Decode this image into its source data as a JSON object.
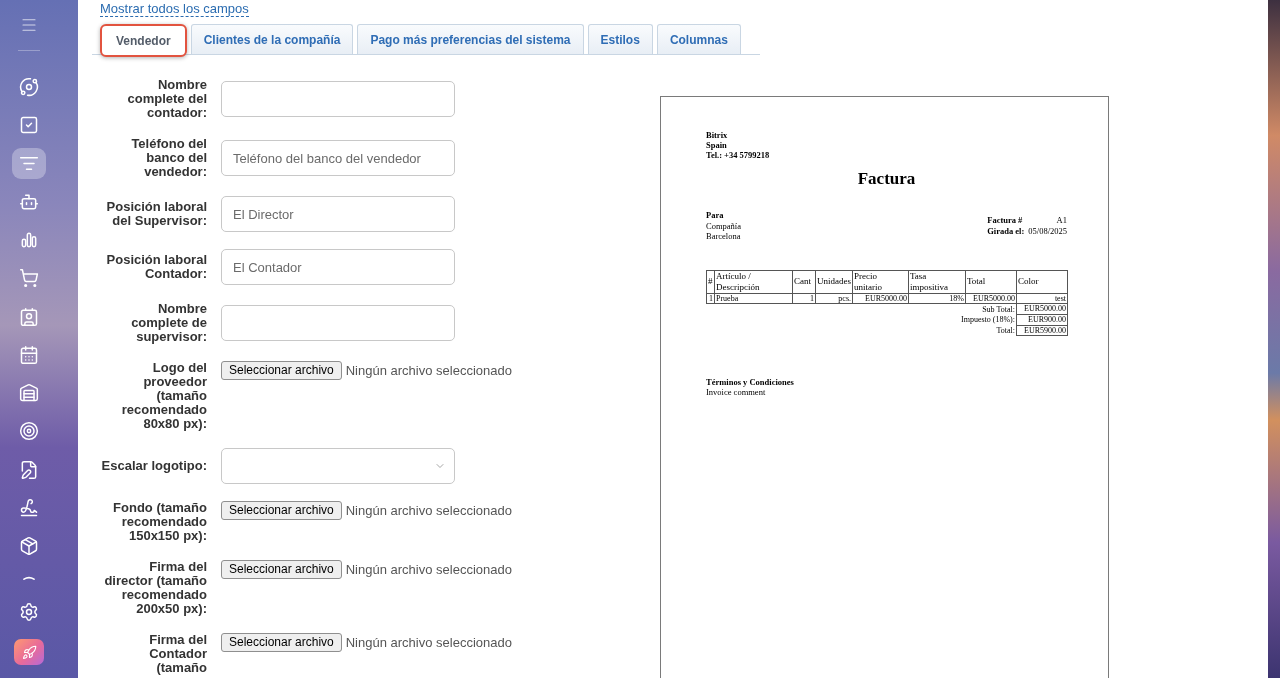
{
  "sidebar": {
    "nav_items": [
      {
        "selected": false
      },
      {
        "selected": false
      },
      {
        "selected": true
      },
      {
        "selected": false
      },
      {
        "selected": false
      },
      {
        "selected": false
      },
      {
        "selected": false
      },
      {
        "selected": false
      },
      {
        "selected": false
      },
      {
        "selected": false
      },
      {
        "selected": false
      },
      {
        "selected": false
      },
      {
        "selected": false
      }
    ]
  },
  "link": "Mostrar todos los campos",
  "tabs": [
    {
      "label": "Vendedor",
      "selected": true,
      "highlighted": true
    },
    {
      "label": "Clientes de la compañía",
      "selected": false,
      "highlighted": false
    },
    {
      "label": "Pago más preferencias del sistema",
      "selected": false,
      "highlighted": false
    },
    {
      "label": "Estilos",
      "selected": false,
      "highlighted": false
    },
    {
      "label": "Columnas",
      "selected": false,
      "highlighted": false
    }
  ],
  "form": {
    "fields": [
      {
        "kind": "text",
        "label": "Nombre complete del contador:"
      },
      {
        "kind": "text",
        "label": "Teléfono del banco del vendedor:",
        "placeholder": "Teléfono del banco del vendedor"
      },
      {
        "kind": "text",
        "label": "Posición laboral del Supervisor:",
        "placeholder": "El Director"
      },
      {
        "kind": "text",
        "label": "Posición laboral Contador:",
        "placeholder": "El Contador"
      },
      {
        "kind": "text",
        "label": "Nombre complete de supervisor:"
      },
      {
        "kind": "file",
        "label": "Logo del proveedor (tamaño recomendado 80x80 px):",
        "button": "Seleccionar archivo",
        "status": "Ningún archivo seleccionado"
      },
      {
        "kind": "select",
        "label": "Escalar logotipo:"
      },
      {
        "kind": "file",
        "label": "Fondo (tamaño recomendado 150x150 px):",
        "button": "Seleccionar archivo",
        "status": "Ningún archivo seleccionado"
      },
      {
        "kind": "file",
        "label": "Firma del director (tamaño recomendado 200x50 px):",
        "button": "Seleccionar archivo",
        "status": "Ningún archivo seleccionado"
      },
      {
        "kind": "file",
        "label": "Firma del Contador (tamaño",
        "button": "Seleccionar archivo",
        "status": "Ningún archivo seleccionado"
      }
    ]
  },
  "preview": {
    "seller_lines": [
      "Bitrix",
      "Spain",
      "Tel.: +34 5799218"
    ],
    "title": "Factura",
    "recipient_heading": "Para",
    "recipient_lines": [
      "Compañía",
      "Barcelona"
    ],
    "meta": [
      {
        "label": "Factura #",
        "value": "A1"
      },
      {
        "label": "Girada el:",
        "value": "05/08/2025"
      }
    ],
    "table": {
      "columns": [
        "#",
        "Artículo / Descripción",
        "Cant",
        "Unidades",
        "Precio unitario",
        "Tasa impositiva",
        "Total",
        "Color"
      ],
      "rows": [
        [
          "1",
          "Prueba",
          "1",
          "pcs.",
          "EUR5000.00",
          "18%",
          "EUR5000.00",
          "test"
        ]
      ],
      "totals": [
        {
          "label": "Sub Total:",
          "value": "EUR5000.00"
        },
        {
          "label": "Impuesto (18%):",
          "value": "EUR900.00"
        },
        {
          "label": "Total:",
          "value": "EUR5900.00"
        }
      ]
    },
    "terms_heading": "Términos y Condiciones",
    "terms_text": "Invoice comment"
  }
}
